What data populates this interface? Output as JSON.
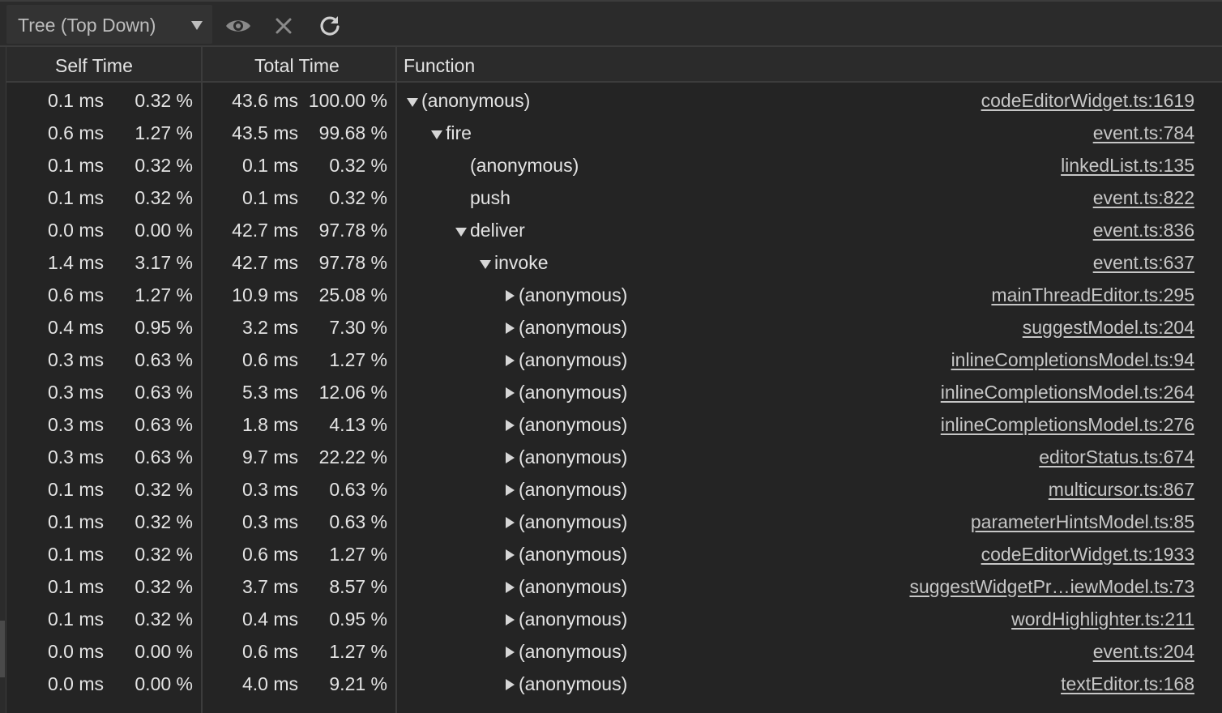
{
  "toolbar": {
    "view_mode": "Tree (Top Down)",
    "icons": [
      "chevron-down-icon",
      "eye-icon",
      "close-icon",
      "refresh-icon"
    ]
  },
  "columns": {
    "self_time": "Self Time",
    "total_time": "Total Time",
    "function": "Function"
  },
  "colors": {
    "background": "#242424",
    "toolbar": "#2b2b2b",
    "text": "#e3e3e3",
    "link": "#c6c6c6"
  },
  "rows": [
    {
      "self_ms": "0.1 ms",
      "self_pct": "0.32 %",
      "total_ms": "43.6 ms",
      "total_pct": "100.00 %",
      "depth": 0,
      "toggle": "expanded",
      "function": "(anonymous)",
      "location": "codeEditorWidget.ts:1619"
    },
    {
      "self_ms": "0.6 ms",
      "self_pct": "1.27 %",
      "total_ms": "43.5 ms",
      "total_pct": "99.68 %",
      "depth": 1,
      "toggle": "expanded",
      "function": "fire",
      "location": "event.ts:784"
    },
    {
      "self_ms": "0.1 ms",
      "self_pct": "0.32 %",
      "total_ms": "0.1 ms",
      "total_pct": "0.32 %",
      "depth": 2,
      "toggle": "none",
      "function": "(anonymous)",
      "location": "linkedList.ts:135"
    },
    {
      "self_ms": "0.1 ms",
      "self_pct": "0.32 %",
      "total_ms": "0.1 ms",
      "total_pct": "0.32 %",
      "depth": 2,
      "toggle": "none",
      "function": "push",
      "location": "event.ts:822"
    },
    {
      "self_ms": "0.0 ms",
      "self_pct": "0.00 %",
      "total_ms": "42.7 ms",
      "total_pct": "97.78 %",
      "depth": 2,
      "toggle": "expanded",
      "function": "deliver",
      "location": "event.ts:836"
    },
    {
      "self_ms": "1.4 ms",
      "self_pct": "3.17 %",
      "total_ms": "42.7 ms",
      "total_pct": "97.78 %",
      "depth": 3,
      "toggle": "expanded",
      "function": "invoke",
      "location": "event.ts:637"
    },
    {
      "self_ms": "0.6 ms",
      "self_pct": "1.27 %",
      "total_ms": "10.9 ms",
      "total_pct": "25.08 %",
      "depth": 4,
      "toggle": "collapsed",
      "function": "(anonymous)",
      "location": "mainThreadEditor.ts:295"
    },
    {
      "self_ms": "0.4 ms",
      "self_pct": "0.95 %",
      "total_ms": "3.2 ms",
      "total_pct": "7.30 %",
      "depth": 4,
      "toggle": "collapsed",
      "function": "(anonymous)",
      "location": "suggestModel.ts:204"
    },
    {
      "self_ms": "0.3 ms",
      "self_pct": "0.63 %",
      "total_ms": "0.6 ms",
      "total_pct": "1.27 %",
      "depth": 4,
      "toggle": "collapsed",
      "function": "(anonymous)",
      "location": "inlineCompletionsModel.ts:94"
    },
    {
      "self_ms": "0.3 ms",
      "self_pct": "0.63 %",
      "total_ms": "5.3 ms",
      "total_pct": "12.06 %",
      "depth": 4,
      "toggle": "collapsed",
      "function": "(anonymous)",
      "location": "inlineCompletionsModel.ts:264"
    },
    {
      "self_ms": "0.3 ms",
      "self_pct": "0.63 %",
      "total_ms": "1.8 ms",
      "total_pct": "4.13 %",
      "depth": 4,
      "toggle": "collapsed",
      "function": "(anonymous)",
      "location": "inlineCompletionsModel.ts:276"
    },
    {
      "self_ms": "0.3 ms",
      "self_pct": "0.63 %",
      "total_ms": "9.7 ms",
      "total_pct": "22.22 %",
      "depth": 4,
      "toggle": "collapsed",
      "function": "(anonymous)",
      "location": "editorStatus.ts:674"
    },
    {
      "self_ms": "0.1 ms",
      "self_pct": "0.32 %",
      "total_ms": "0.3 ms",
      "total_pct": "0.63 %",
      "depth": 4,
      "toggle": "collapsed",
      "function": "(anonymous)",
      "location": "multicursor.ts:867"
    },
    {
      "self_ms": "0.1 ms",
      "self_pct": "0.32 %",
      "total_ms": "0.3 ms",
      "total_pct": "0.63 %",
      "depth": 4,
      "toggle": "collapsed",
      "function": "(anonymous)",
      "location": "parameterHintsModel.ts:85"
    },
    {
      "self_ms": "0.1 ms",
      "self_pct": "0.32 %",
      "total_ms": "0.6 ms",
      "total_pct": "1.27 %",
      "depth": 4,
      "toggle": "collapsed",
      "function": "(anonymous)",
      "location": "codeEditorWidget.ts:1933"
    },
    {
      "self_ms": "0.1 ms",
      "self_pct": "0.32 %",
      "total_ms": "3.7 ms",
      "total_pct": "8.57 %",
      "depth": 4,
      "toggle": "collapsed",
      "function": "(anonymous)",
      "location": "suggestWidgetPr…iewModel.ts:73"
    },
    {
      "self_ms": "0.1 ms",
      "self_pct": "0.32 %",
      "total_ms": "0.4 ms",
      "total_pct": "0.95 %",
      "depth": 4,
      "toggle": "collapsed",
      "function": "(anonymous)",
      "location": "wordHighlighter.ts:211"
    },
    {
      "self_ms": "0.0 ms",
      "self_pct": "0.00 %",
      "total_ms": "0.6 ms",
      "total_pct": "1.27 %",
      "depth": 4,
      "toggle": "collapsed",
      "function": "(anonymous)",
      "location": "event.ts:204"
    },
    {
      "self_ms": "0.0 ms",
      "self_pct": "0.00 %",
      "total_ms": "4.0 ms",
      "total_pct": "9.21 %",
      "depth": 4,
      "toggle": "collapsed",
      "function": "(anonymous)",
      "location": "textEditor.ts:168"
    }
  ]
}
